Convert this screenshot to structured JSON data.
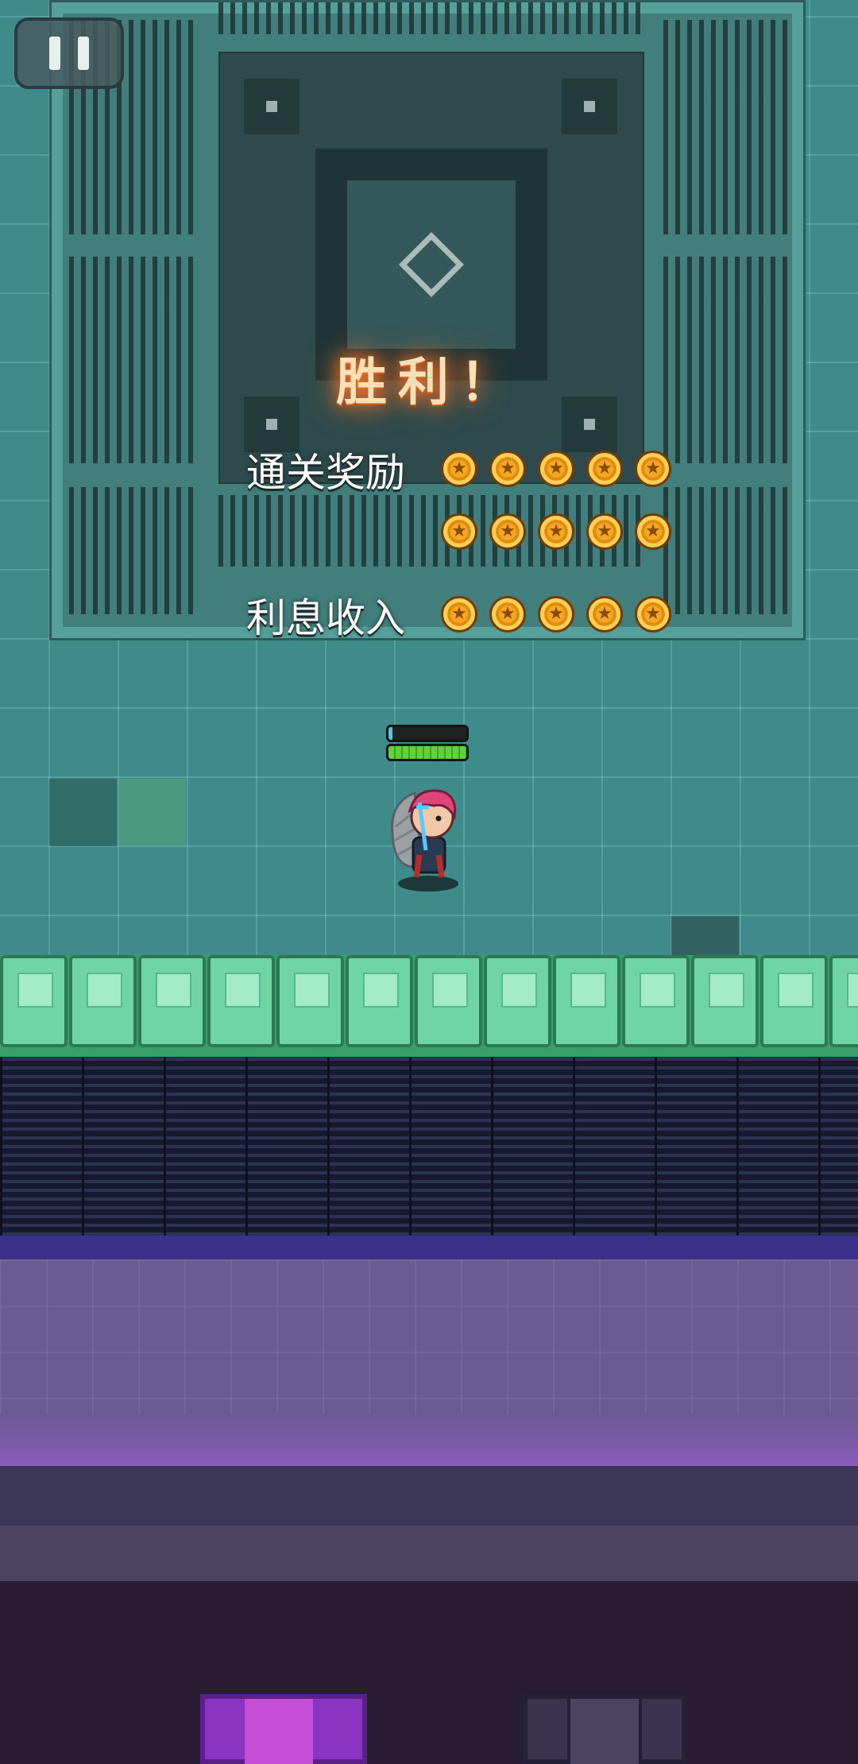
{
  "hud": {
    "pause_icon": "pause-icon"
  },
  "results": {
    "title": "胜利！",
    "rewards": [
      {
        "label": "通关奖励",
        "rows": [
          {
            "coins": 5
          },
          {
            "coins": 5
          }
        ]
      },
      {
        "label": "利息收入",
        "rows": [
          {
            "coins": 5
          }
        ]
      }
    ],
    "coin_icon": "star-coin-icon",
    "coin_glyph": "★"
  },
  "player": {
    "shield_level": 0.05,
    "health_level": 1.0,
    "shield_color": "#4ec3e8",
    "health_color": "#5ed43c"
  },
  "colors": {
    "victory_glow": "#ff7a2a",
    "floor": "#3f8a8b",
    "wall_block": "#6fd6a3"
  }
}
